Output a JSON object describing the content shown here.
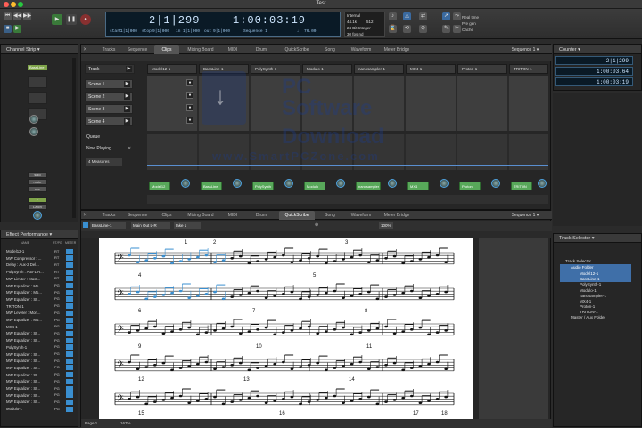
{
  "window": {
    "title": "Test"
  },
  "transport": {
    "position_bars": "2|1|299",
    "position_time": "1:00:03:19",
    "start_label": "start",
    "start_value": "1|1|000",
    "stop_label": "stop",
    "stop_value": "9|1|000",
    "in_label": "in",
    "in_value": "1|1|000",
    "out_label": "out",
    "out_value": "9|1|000",
    "sequence_label": "Sequence 1",
    "tempo": "76.00",
    "sync_internal": "Internal",
    "sample_rate": "44.1k",
    "buffer": "512",
    "bit_depth": "24 Bit Integer",
    "frame_rate": "30 fps nd",
    "status_lines": [
      "Real time",
      "Pre gen",
      "Cache"
    ]
  },
  "channel_strip": {
    "title": "Channel Strip",
    "track_label": "BassLine",
    "buttons": [
      "solo",
      "mute",
      "rec"
    ],
    "latch": "Latch"
  },
  "top_tabs": [
    "Tracks",
    "Sequence",
    "Clips",
    "Mixing Board",
    "MIDI",
    "Drum",
    "QuickScribe",
    "Song",
    "Waveform",
    "Meter Bridge"
  ],
  "top_active_tab": "Clips",
  "bottom_tabs": [
    "Tracks",
    "Sequence",
    "Clips",
    "Mixing Board",
    "MIDI",
    "Drum",
    "QuickScribe",
    "Song",
    "Waveform",
    "Meter Bridge"
  ],
  "bottom_active_tab": "QuickScribe",
  "sequence_selector": "Sequence 1",
  "clips": {
    "track_label": "Track",
    "scenes": [
      "Scene 1",
      "Scene 2",
      "Scene 3",
      "Scene 4"
    ],
    "queue_label": "Queue",
    "now_playing_label": "Now Playing",
    "measures": "4 Measures",
    "tracks": [
      "Model12-1",
      "BassLine-1",
      "PolySynth-1",
      "Modulo-1",
      "nanosampler-1",
      "MX4-1",
      "Proton-1",
      "TRITON-1"
    ],
    "chips": [
      "Model12",
      "BassLine",
      "PolySynth",
      "Modulo",
      "nanosampler",
      "MX4",
      "Proton",
      "TRITON"
    ]
  },
  "counter": {
    "title": "Counter",
    "rows": [
      "2|1|299",
      "1:00:03.64",
      "1:00:03:19"
    ]
  },
  "effect_performance": {
    "title": "Effect Performance",
    "col_name": "NAME",
    "col_rt": "RT/PG",
    "col_meter": "METER",
    "rows": [
      {
        "name": "Model12-1",
        "mode": "RT"
      },
      {
        "name": "MW Compressor : ...",
        "mode": "RT"
      },
      {
        "name": "Delay : Aux-2 Del...",
        "mode": "RT"
      },
      {
        "name": "PolySynth : Aux-1 R...",
        "mode": "RT"
      },
      {
        "name": "MW Limiter : Mast...",
        "mode": "RT"
      },
      {
        "name": "MW Equalizer : Mo...",
        "mode": "PG"
      },
      {
        "name": "MW Equalizer : Mo...",
        "mode": "PG"
      },
      {
        "name": "MW Equalizer : St...",
        "mode": "PG"
      },
      {
        "name": "TRITON-1",
        "mode": "PG"
      },
      {
        "name": "MW Leveler : Mon...",
        "mode": "PG"
      },
      {
        "name": "MW Equalizer : Mo...",
        "mode": "PG"
      },
      {
        "name": "MX4-1",
        "mode": "PG"
      },
      {
        "name": "MW Equalizer : St...",
        "mode": "PG"
      },
      {
        "name": "MW Equalizer : St...",
        "mode": "PG"
      },
      {
        "name": "PolySynth-1",
        "mode": "PG"
      },
      {
        "name": "MW Equalizer : St...",
        "mode": "PG"
      },
      {
        "name": "MW Equalizer : St...",
        "mode": "PG"
      },
      {
        "name": "MW Equalizer : St...",
        "mode": "PG"
      },
      {
        "name": "MW Equalizer : St...",
        "mode": "PG"
      },
      {
        "name": "MW Equalizer : St...",
        "mode": "PG"
      },
      {
        "name": "MW Equalizer : St...",
        "mode": "PG"
      },
      {
        "name": "MW Equalizer : St...",
        "mode": "PG"
      },
      {
        "name": "MW Equalizer : St...",
        "mode": "PG"
      },
      {
        "name": "Modulo-1",
        "mode": "PG"
      }
    ]
  },
  "quickscribe": {
    "track_select": "BassLine-1",
    "output_select": "Main Out L-R",
    "take_select": "take 1",
    "zoom": "100%",
    "page_label": "Page 1",
    "zoom_bottom": "167%",
    "measure_numbers": [
      "1",
      "2",
      "3",
      "4",
      "5",
      "6",
      "7",
      "8",
      "9",
      "10",
      "11",
      "12",
      "13",
      "14",
      "15",
      "16",
      "17",
      "18"
    ]
  },
  "track_selector": {
    "title": "Track Selector",
    "root": "Track Selector",
    "folder": "Audio Folder",
    "items": [
      "Model12-1",
      "BassLine-1",
      "PolySynth-1",
      "Modulo-1",
      "nanosampler-1",
      "MX4-1",
      "Proton-1",
      "TRITON-1"
    ],
    "master": "Master / Aux Folder"
  },
  "watermark": {
    "line1": "PC",
    "line2": "Software",
    "line3": "Download",
    "line4": "www.SmartPCZone.com"
  },
  "colors": {
    "accent": "#3f6fa8",
    "clip_green": "#58a85a",
    "lcd_bg": "#0a1a26",
    "note_blue": "#3a8fd0"
  }
}
